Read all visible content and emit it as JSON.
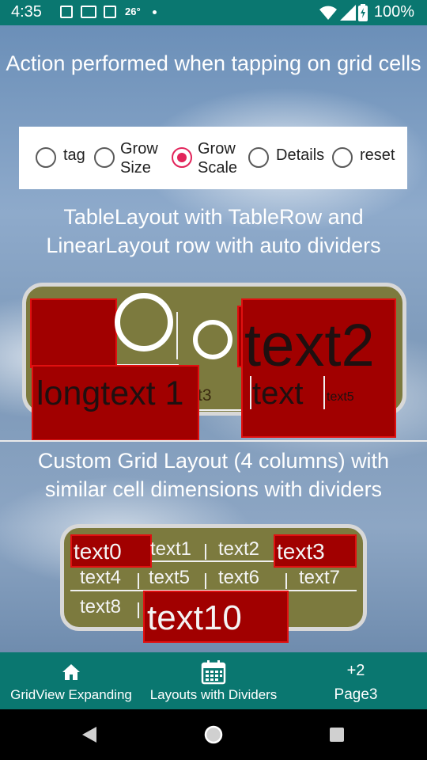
{
  "status_bar": {
    "time": "4:35",
    "temperature": "26°",
    "battery": "100%"
  },
  "header": {
    "title": "Action performed when tapping on grid cells"
  },
  "radio_group": {
    "options": [
      {
        "label": "tag",
        "selected": false
      },
      {
        "label": "Grow Size",
        "selected": false
      },
      {
        "label": "Grow Scale",
        "selected": true
      },
      {
        "label": "Details",
        "selected": false
      },
      {
        "label": "reset",
        "selected": false
      }
    ],
    "accent_color": "#e2245a"
  },
  "table_section": {
    "title": "TableLayout with TableRow and LinearLayout row with auto dividers",
    "cells": {
      "top_left_text": "longtext",
      "big_longtext": "longtext 1",
      "text3_partial": "t3",
      "text2_partial": "text2",
      "text_under": "text",
      "text5_small": "text5"
    }
  },
  "grid_section": {
    "title": "Custom Grid Layout (4 columns) with similar cell dimensions with dividers",
    "cells": [
      "text0",
      "text1",
      "text2",
      "text3",
      "text4",
      "text5",
      "text6",
      "text7",
      "text8",
      "text10"
    ]
  },
  "bottom_nav": {
    "items": [
      {
        "label": "GridView Expanding",
        "icon": "home-icon"
      },
      {
        "label": "Layouts with Dividers",
        "icon": "calendar-icon"
      },
      {
        "label": "Page3",
        "icon_text": "+2"
      }
    ],
    "background": "#0a7770"
  },
  "system_nav": {
    "buttons": [
      "back-icon",
      "home-circle-icon",
      "recents-icon"
    ]
  }
}
